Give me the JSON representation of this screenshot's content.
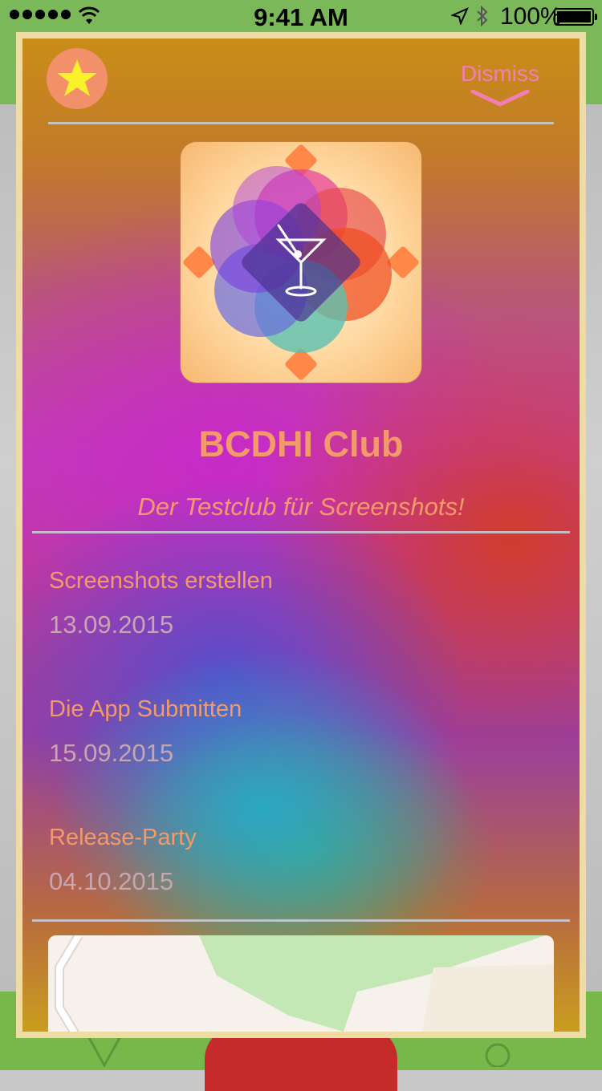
{
  "status_bar": {
    "time": "9:41 AM",
    "battery_percent": "100%",
    "signal_icon": "signal-dots-icon",
    "wifi_icon": "wifi-icon",
    "location_icon": "location-arrow-icon",
    "bluetooth_icon": "bluetooth-icon",
    "battery_icon": "battery-full-icon"
  },
  "modal": {
    "favorite_icon": "star-icon",
    "dismiss_label": "Dismiss",
    "dismiss_icon": "chevron-down-icon",
    "app_icon": "cocktail-glass-icon",
    "club_name": "BCDHI Club",
    "club_tagline": "Der Testclub für Screenshots!",
    "events": [
      {
        "name": "Screenshots erstellen",
        "date": "13.09.2015"
      },
      {
        "name": "Die App Submitten",
        "date": "15.09.2015"
      },
      {
        "name": "Release-Party",
        "date": "04.10.2015"
      }
    ]
  },
  "colors": {
    "accent_text": "#f39a6b",
    "date_text": "#c9a5b0",
    "dismiss_text": "#f27fb4",
    "star": "#f7f22a",
    "star_bg": "#f2906a",
    "card_border": "#efdba4"
  }
}
